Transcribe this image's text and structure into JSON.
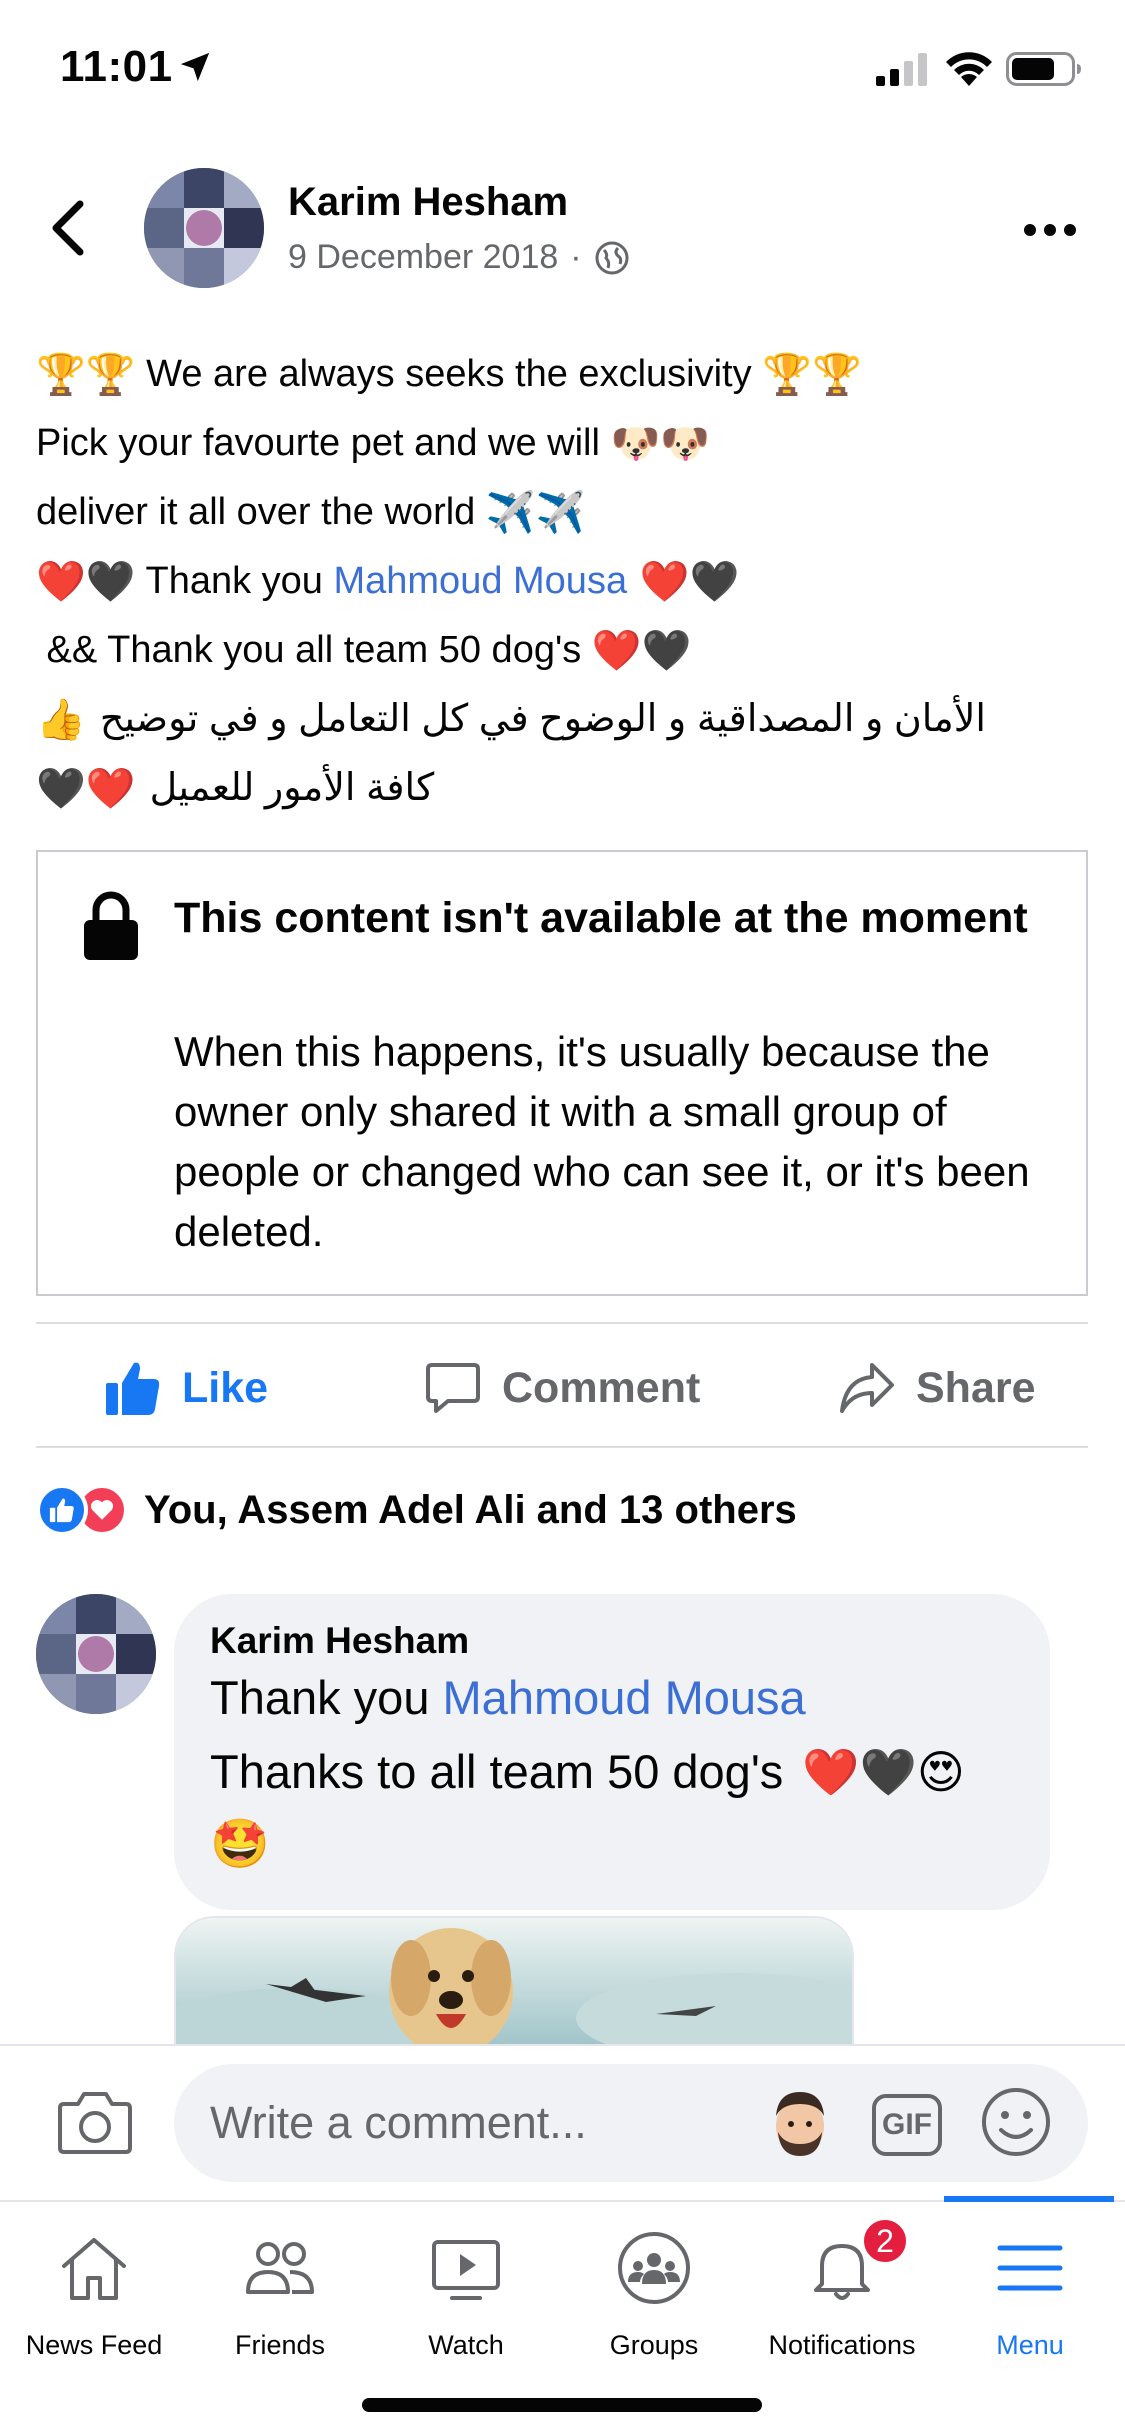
{
  "status_bar": {
    "time": "11:01"
  },
  "post": {
    "author": "Karim Hesham",
    "date": "9 December 2018",
    "separator": "·",
    "privacy_icon": "globe-icon",
    "text": {
      "l1_a": "🏆🏆",
      "l1_b": " We are always seeks the exclusivity ",
      "l1_c": "🏆🏆",
      "l2_a": "Pick your favourte pet and we will ",
      "l2_b": "🐶🐶",
      "l3_a": "deliver it all over the world ",
      "l3_b": "✈️✈️",
      "l4_a": "❤️🖤",
      "l4_b": " Thank you ",
      "l4_mention": "Mahmoud Mousa",
      "l4_c": " ❤️🖤",
      "l5_a": " && Thank you all team 50 dog's ",
      "l5_b": "❤️🖤",
      "l6_text": "الأمان و المصداقية و الوضوح في كل التعامل و في توضيح",
      "l6_emoji": "👍",
      "l7_text": "كافة الأمور للعميل",
      "l7_emoji": "❤️🖤"
    }
  },
  "unavailable": {
    "title": "This content isn't available at the moment",
    "body": "When this happens, it's usually because the owner only shared it with a small group of people or changed who can see it, or it's been deleted."
  },
  "actions": {
    "like": "Like",
    "comment": "Comment",
    "share": "Share"
  },
  "reactions": {
    "summary": "You, Assem Adel Ali and 13 others"
  },
  "comment": {
    "author": "Karim Hesham",
    "line1_prefix": "Thank you ",
    "line1_mention": "Mahmoud Mousa",
    "line2": "Thanks to all team 50 dog's ",
    "line2_emoji": "❤️🖤😍",
    "line3_emoji": "🤩"
  },
  "composer": {
    "placeholder": "Write a comment...",
    "gif_label": "GIF"
  },
  "tabs": [
    {
      "label": "News Feed",
      "icon": "home-icon"
    },
    {
      "label": "Friends",
      "icon": "friends-icon"
    },
    {
      "label": "Watch",
      "icon": "watch-icon"
    },
    {
      "label": "Groups",
      "icon": "groups-icon"
    },
    {
      "label": "Notifications",
      "icon": "bell-icon",
      "badge": "2"
    },
    {
      "label": "Menu",
      "icon": "menu-icon",
      "active": true
    }
  ],
  "colors": {
    "accent": "#1877f2",
    "mention": "#3b6fd4",
    "badge": "#e41e3f",
    "love": "#f33e58"
  }
}
